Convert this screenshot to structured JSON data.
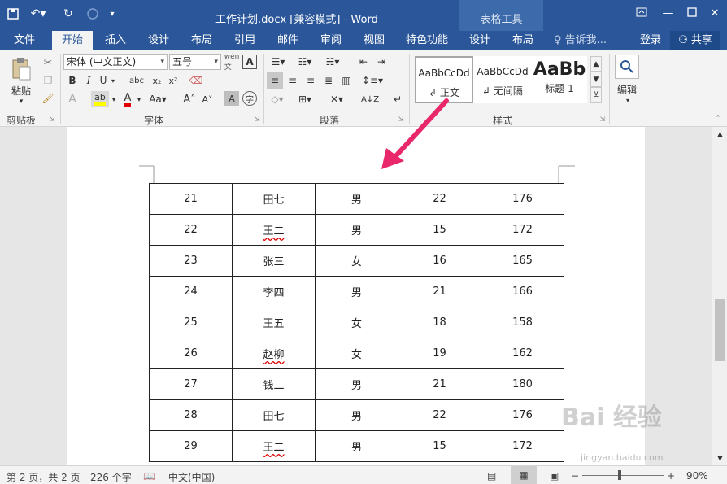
{
  "window": {
    "title": "工作计划.docx [兼容模式] - Word",
    "context_group": "表格工具",
    "controls": [
      "ribbon-options",
      "minimize",
      "maximize",
      "close"
    ]
  },
  "tabs": [
    {
      "label": "文件",
      "active": false
    },
    {
      "label": "开始",
      "active": true
    },
    {
      "label": "插入",
      "active": false
    },
    {
      "label": "设计",
      "active": false
    },
    {
      "label": "布局",
      "active": false
    },
    {
      "label": "引用",
      "active": false
    },
    {
      "label": "邮件",
      "active": false
    },
    {
      "label": "审阅",
      "active": false
    },
    {
      "label": "视图",
      "active": false
    },
    {
      "label": "特色功能",
      "active": false
    },
    {
      "label": "设计",
      "active": false
    },
    {
      "label": "布局",
      "active": false
    }
  ],
  "tell_me": "告诉我...",
  "login": "登录",
  "share": "共享",
  "ribbon": {
    "clipboard": {
      "label": "剪贴板",
      "paste": "粘贴"
    },
    "font": {
      "label": "字体",
      "font_name": "宋体 (中文正文)",
      "font_size": "五号"
    },
    "paragraph": {
      "label": "段落"
    },
    "styles": {
      "label": "样式",
      "items": [
        {
          "sample": "AaBbCcDd",
          "name": "正文",
          "selected": true
        },
        {
          "sample": "AaBbCcDd",
          "name": "无间隔",
          "selected": false
        },
        {
          "sample": "AaBb",
          "name": "标题 1",
          "selected": false
        }
      ]
    },
    "editing": {
      "label": "编辑"
    }
  },
  "table": {
    "rows": [
      [
        "21",
        "田七",
        "男",
        "22",
        "176"
      ],
      [
        "22",
        "王二",
        "男",
        "15",
        "172"
      ],
      [
        "23",
        "张三",
        "女",
        "16",
        "165"
      ],
      [
        "24",
        "李四",
        "男",
        "21",
        "166"
      ],
      [
        "25",
        "王五",
        "女",
        "18",
        "158"
      ],
      [
        "26",
        "赵柳",
        "女",
        "19",
        "162"
      ],
      [
        "27",
        "钱二",
        "男",
        "21",
        "180"
      ],
      [
        "28",
        "田七",
        "男",
        "22",
        "176"
      ],
      [
        "29",
        "王二",
        "男",
        "15",
        "172"
      ]
    ]
  },
  "statusbar": {
    "page": "第 2 页，共 2 页",
    "words": "226 个字",
    "language": "中文(中国)",
    "zoom": "90%"
  },
  "watermark": {
    "text": "Bai 经验",
    "url": "jingyan.baidu.com"
  },
  "colors": {
    "brand": "#2b579a",
    "arrow": "#e8286b",
    "highlight": "#ffff00",
    "font_red": "#e00000"
  }
}
